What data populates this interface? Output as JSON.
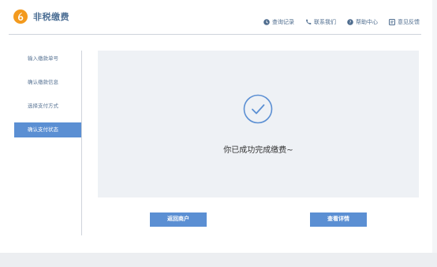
{
  "app": {
    "title": "非税缴费",
    "logo_glyph": "6",
    "brand_color": "#f39a1e"
  },
  "top_links": [
    {
      "icon": "record-icon",
      "label": "查询记录"
    },
    {
      "icon": "phone-icon",
      "label": "联系我们"
    },
    {
      "icon": "help-icon",
      "label": "帮助中心"
    },
    {
      "icon": "feedback-icon",
      "label": "意见反馈"
    }
  ],
  "steps": [
    {
      "label": "输入缴款单号",
      "active": false
    },
    {
      "label": "确认缴款信息",
      "active": false
    },
    {
      "label": "选择支付方式",
      "active": false
    },
    {
      "label": "确认支付状态",
      "active": true
    }
  ],
  "result": {
    "icon": "check-circle-icon",
    "message": "你已成功完成缴费~"
  },
  "buttons": {
    "back_label": "返回商户",
    "detail_label": "查看详情"
  },
  "colors": {
    "accent": "#5b8fd3",
    "link": "#4e6c8e",
    "panel_bg": "#eef1f5"
  }
}
